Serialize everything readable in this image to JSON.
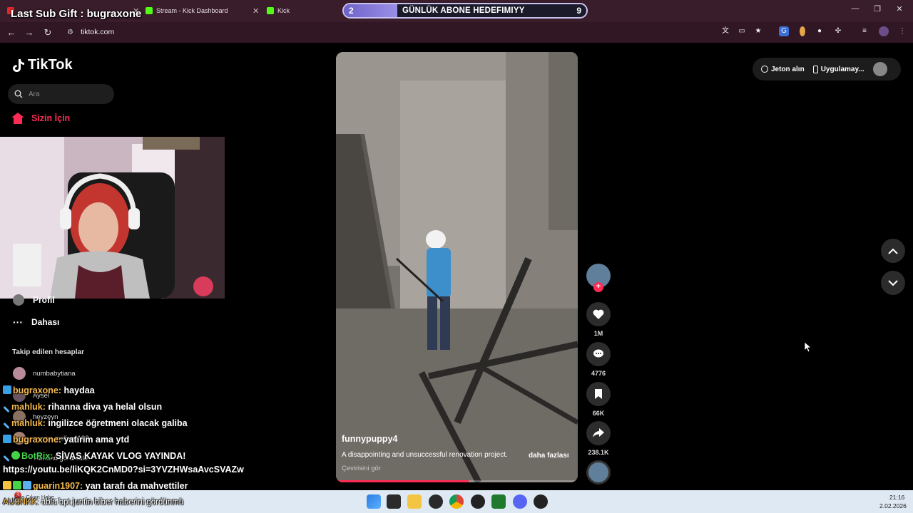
{
  "browser": {
    "tabs": [
      {
        "label": "",
        "favicon_color": "#e02b2b"
      },
      {
        "label": "Stream - Kick Dashboard",
        "favicon_color": "#53fc18"
      },
      {
        "label": "Kick",
        "favicon_color": "#53fc18"
      }
    ],
    "url": "tiktok.com"
  },
  "overlays": {
    "last_sub": "Last Sub Gift : bugraxone",
    "goal": {
      "current": "2",
      "label": "GÜNLÜK ABONE HEDEFIMIYY",
      "target": "9",
      "progress": 0.22
    }
  },
  "tiktok": {
    "logo": "TikTok",
    "search_placeholder": "Ara",
    "nav": {
      "for_you": "Sizin İçin",
      "profile": "Profil",
      "more": "Dahası"
    },
    "following_title": "Takip edilen hesaplar",
    "accounts": [
      "numbabytiana",
      "Aysel",
      "heyzeyn",
      "sevmə melisa1122",
      "Tümünü görüntüle"
    ],
    "top_right": {
      "coins": "Jeton alın",
      "app": "Uygulamay..."
    },
    "video": {
      "author": "funnypuppy4",
      "description": "A disappointing and unsuccessful renovation project.",
      "more": "daha fazlası",
      "translate": "Çevirisini gör",
      "progress": 0.55
    },
    "actions": {
      "likes": "1M",
      "comments": "4776",
      "saves": "66K",
      "shares": "238.1K"
    }
  },
  "chat": [
    {
      "user": "bugraxone:",
      "text": " haydaa"
    },
    {
      "user": "mahluk:",
      "text": " rihanna diva ya helal olsun"
    },
    {
      "user": "mahluk:",
      "text": " ingilizce öğretmeni olacak galiba"
    },
    {
      "user": "bugraxone:",
      "text": " yatırım ama ytd"
    },
    {
      "user": "BotRix:",
      "text": " SİVAS KAYAK VLOG YAYINDA!"
    },
    {
      "user": "",
      "text": "https://youtu.be/liKQK2CnMD0?si=3YVZHWsaAvcSVAZw"
    },
    {
      "user": "guarin1907:",
      "text": " yan tarafı da mahvettiler"
    },
    {
      "user": "AUSNKK:",
      "text": " abla bpt juntin biber haberini gördünmü"
    }
  ],
  "taskbar": {
    "news": "Öne Çıkan Habe...",
    "news_badge": "2",
    "time": "21:16",
    "date": "2.02.2026"
  }
}
